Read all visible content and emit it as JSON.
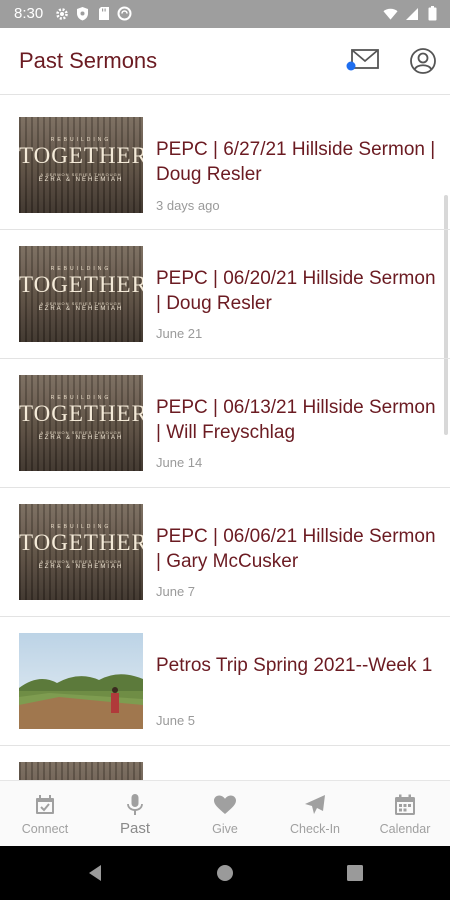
{
  "status_bar": {
    "time": "8:30",
    "left_icons": [
      "gear-icon",
      "shield-icon",
      "sd-card-icon",
      "sync-icon"
    ],
    "right_icons": [
      "wifi-icon",
      "signal-icon",
      "battery-icon"
    ]
  },
  "header": {
    "title": "Past Sermons",
    "actions": [
      "mail-icon",
      "account-icon"
    ],
    "notification_dot_color": "#1e6ef0"
  },
  "thumb_art": {
    "series_top": "REBUILDING",
    "series_title": "TOGETHER",
    "series_sub": "A SERMON SERIES THROUGH",
    "series_books": "EZRA & NEHEMIAH"
  },
  "sermons": [
    {
      "title": "PEPC | 6/27/21 Hillside Sermon | Doug Resler",
      "date": "3 days ago",
      "thumb": "series"
    },
    {
      "title": "PEPC | 06/20/21 Hillside Sermon | Doug Resler",
      "date": "June 21",
      "thumb": "series"
    },
    {
      "title": "PEPC | 06/13/21 Hillside Sermon | Will Freyschlag",
      "date": "June 14",
      "thumb": "series"
    },
    {
      "title": "PEPC | 06/06/21 Hillside Sermon | Gary McCusker",
      "date": "June 7",
      "thumb": "series"
    },
    {
      "title": "Petros Trip Spring 2021--Week 1",
      "date": "June 5",
      "thumb": "photo"
    }
  ],
  "tabs": [
    {
      "label": "Connect",
      "icon": "calendar-check-icon",
      "active": false
    },
    {
      "label": "Past",
      "icon": "microphone-icon",
      "active": true
    },
    {
      "label": "Give",
      "icon": "heart-icon",
      "active": false
    },
    {
      "label": "Check-In",
      "icon": "paper-plane-icon",
      "active": false
    },
    {
      "label": "Calendar",
      "icon": "calendar-icon",
      "active": false
    }
  ],
  "colors": {
    "accent": "#6b1b22",
    "status_bar": "#9e9e9e",
    "tab_inactive": "#a0a0a0"
  }
}
